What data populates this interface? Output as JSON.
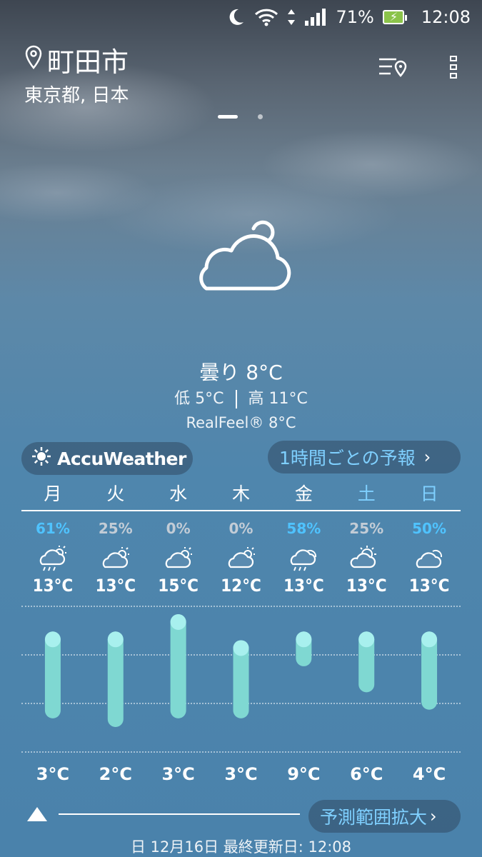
{
  "status_bar": {
    "battery": "71%",
    "time": "12:08"
  },
  "location": {
    "city": "町田市",
    "region": "東京都, 日本"
  },
  "current": {
    "condition": "曇り 8°C",
    "low": "低 5°C",
    "high": "高 11°C",
    "realfeel": "RealFeel® 8°C"
  },
  "accuweather_label": "AccuWeather",
  "hourly_button_label": "1時間ごとの予報",
  "forecast": [
    {
      "day": "月",
      "precip": "61%",
      "high": "13°C",
      "low": "3°C",
      "icon": "cloud-rain-sun-icon",
      "high_value": 13,
      "low_value": 3
    },
    {
      "day": "火",
      "precip": "25%",
      "high": "13°C",
      "low": "2°C",
      "icon": "cloud-sun-icon",
      "high_value": 13,
      "low_value": 2
    },
    {
      "day": "水",
      "precip": "0%",
      "high": "15°C",
      "low": "3°C",
      "icon": "cloud-sun-icon",
      "high_value": 15,
      "low_value": 3
    },
    {
      "day": "木",
      "precip": "0%",
      "high": "12°C",
      "low": "3°C",
      "icon": "cloud-sun-icon",
      "high_value": 12,
      "low_value": 3
    },
    {
      "day": "金",
      "precip": "58%",
      "high": "13°C",
      "low": "9°C",
      "icon": "cloud-rain-icon",
      "high_value": 13,
      "low_value": 9
    },
    {
      "day": "土",
      "precip": "25%",
      "high": "13°C",
      "low": "6°C",
      "icon": "sun-cloud-icon",
      "high_value": 13,
      "low_value": 6
    },
    {
      "day": "日",
      "precip": "50%",
      "high": "13°C",
      "low": "4°C",
      "icon": "cloud-icon",
      "high_value": 13,
      "low_value": 4
    }
  ],
  "expand_button_label": "予測範囲拡大",
  "last_updated": "日 12月16日 最終更新日: 12:08",
  "colors": {
    "bar": "#7fd8d2",
    "bar_cap": "#a8f0ee",
    "accent_blue": "#4fc3ff"
  }
}
